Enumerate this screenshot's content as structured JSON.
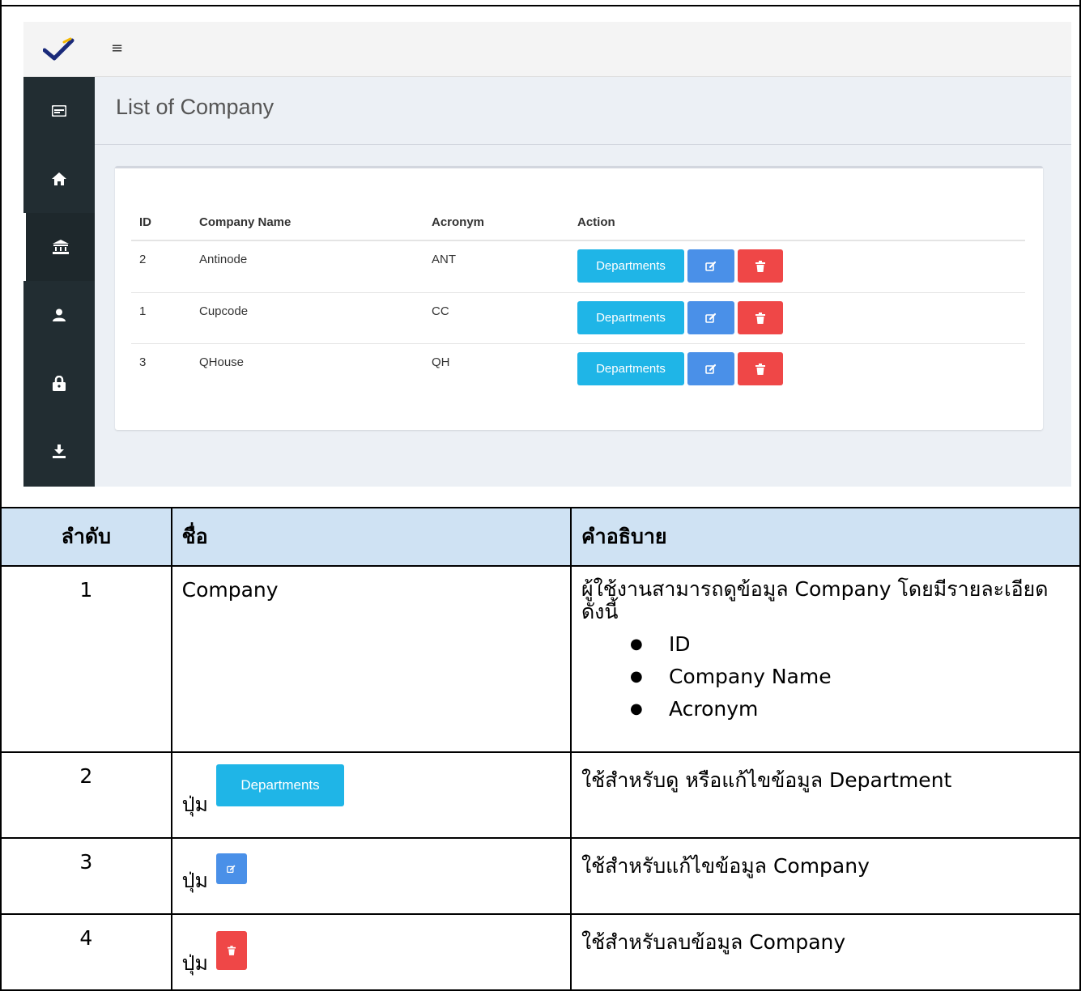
{
  "app": {
    "title": "List of Company",
    "menu_icon": "≡",
    "sidebar": [
      {
        "icon": "id-card-icon"
      },
      {
        "icon": "home-icon"
      },
      {
        "icon": "bank-icon",
        "active": true
      },
      {
        "icon": "user-icon"
      },
      {
        "icon": "lock-icon"
      },
      {
        "icon": "download-icon"
      }
    ]
  },
  "table": {
    "headers": [
      "ID",
      "Company Name",
      "Acronym",
      "Action"
    ],
    "rows": [
      {
        "id": "2",
        "name": "Antinode",
        "acronym": "ANT"
      },
      {
        "id": "1",
        "name": "Cupcode",
        "acronym": "CC"
      },
      {
        "id": "3",
        "name": "QHouse",
        "acronym": "QH"
      }
    ],
    "departments_label": "Departments"
  },
  "doc": {
    "headers": [
      "ลำดับ",
      "ชื่อ",
      "คำอธิบาย"
    ],
    "rows": [
      {
        "no": "1",
        "name": "Company",
        "desc": "ผู้ใช้งานสามารถดูข้อมูล Company โดยมีรายละเอียดดังนี้",
        "list": [
          "ID",
          "Company Name",
          "Acronym"
        ]
      },
      {
        "no": "2",
        "name": "ปุ่ม",
        "button": "Departments",
        "desc": "ใช้สำหรับดู หรือแก้ไขข้อมูล Department"
      },
      {
        "no": "3",
        "name": "ปุ่ม",
        "desc": "ใช้สำหรับแก้ไขข้อมูล Company"
      },
      {
        "no": "4",
        "name": "ปุ่ม",
        "desc": "ใช้สำหรับลบข้อมูล Company"
      }
    ]
  },
  "colors": {
    "departments": "#1fb5e7",
    "edit": "#4a90e8",
    "delete": "#ef4747",
    "sidebar": "#222d32",
    "doc_header": "#cfe2f3"
  }
}
